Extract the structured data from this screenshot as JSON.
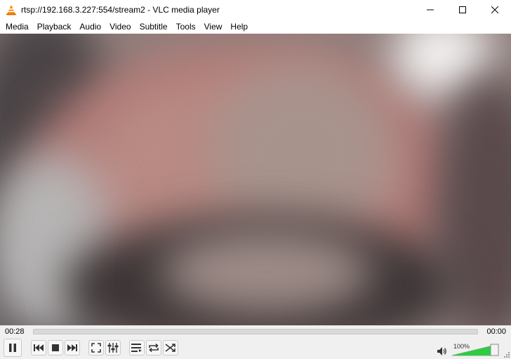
{
  "window": {
    "title": "rtsp://192.168.3.227:554/stream2 - VLC media player",
    "controls": [
      "minimize",
      "maximize",
      "close"
    ]
  },
  "menu": {
    "items": [
      "Media",
      "Playback",
      "Audio",
      "Video",
      "Subtitle",
      "Tools",
      "View",
      "Help"
    ]
  },
  "playback": {
    "elapsed": "00:28",
    "total": "00:00",
    "seek_progress": 0.0,
    "state": "playing"
  },
  "controls": {
    "buttons": [
      "pause-icon",
      "previous-icon",
      "stop-icon",
      "next-icon",
      "fullscreen-icon",
      "extended-settings-icon",
      "playlist-icon",
      "loop-icon",
      "shuffle-icon"
    ]
  },
  "volume": {
    "label": "100%",
    "level": 1.0,
    "accent": "#2ecc40"
  },
  "colors": {
    "brand": "#ff8800",
    "chrome": "#f0f0f0"
  }
}
